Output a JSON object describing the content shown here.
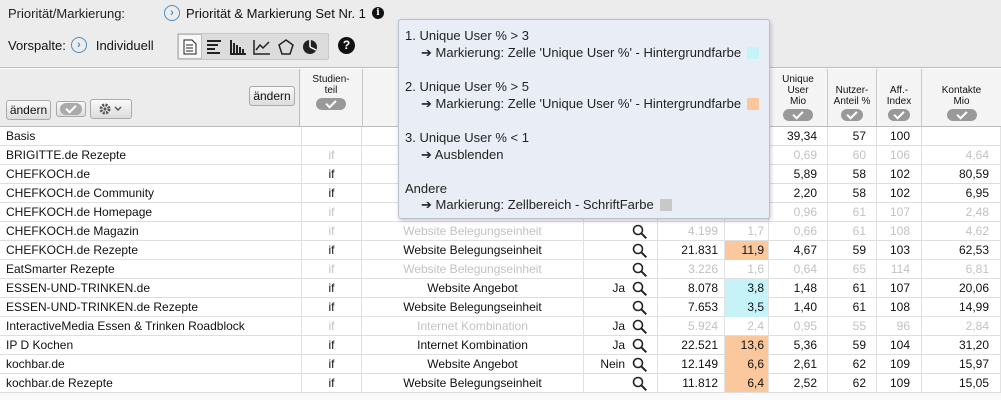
{
  "prio": {
    "label": "Priorität/Markierung:",
    "value": "Priorität & Markierung Set Nr. 1"
  },
  "vorspalte": {
    "label": "Vorspalte:",
    "value": "Individuell"
  },
  "icons": [
    "document-icon",
    "bar-chart-horizontal-icon",
    "bar-chart-vertical-icon",
    "line-chart-icon",
    "pentagon-icon",
    "pie-chart-icon"
  ],
  "help": "?",
  "controls": {
    "aendern1": "ändern",
    "aendern2": "ändern"
  },
  "headers": {
    "studienteil": "Studien-\nteil",
    "unique_user_mio": "Unique\nUser\nMio",
    "nutzer_anteil": "Nutzer-\nAnteil %",
    "aff_index": "Aff.-\nIndex",
    "kontakte_mio": "Kontakte\nMio"
  },
  "rows": [
    {
      "name": "Basis",
      "st": "",
      "ein": "",
      "ja": "",
      "mag": false,
      "bk": "",
      "uu": "",
      "mio": "39,34",
      "na": "57",
      "ai": "100",
      "km": "",
      "grey": false,
      "hl": ""
    },
    {
      "name": "BRIGITTE.de Rezepte",
      "st": "if",
      "ein": "",
      "ja": "",
      "mag": false,
      "bk": "",
      "uu": "",
      "mio": "0,69",
      "na": "60",
      "ai": "106",
      "km": "4,64",
      "grey": true,
      "hl": ""
    },
    {
      "name": "CHEFKOCH.de",
      "st": "if",
      "ein": "",
      "ja": "",
      "mag": false,
      "bk": "",
      "uu": "",
      "mio": "5,89",
      "na": "58",
      "ai": "102",
      "km": "80,59",
      "grey": false,
      "hl": "or"
    },
    {
      "name": "CHEFKOCH.de Community",
      "st": "if",
      "ein": "",
      "ja": "",
      "mag": false,
      "bk": "",
      "uu": "",
      "mio": "2,20",
      "na": "58",
      "ai": "102",
      "km": "6,95",
      "grey": false,
      "hl": "or"
    },
    {
      "name": "CHEFKOCH.de Homepage",
      "st": "if",
      "ein": "",
      "ja": "",
      "mag": false,
      "bk": "",
      "uu": "",
      "mio": "0,96",
      "na": "61",
      "ai": "107",
      "km": "2,48",
      "grey": true,
      "hl": ""
    },
    {
      "name": "CHEFKOCH.de Magazin",
      "st": "if",
      "ein": "Website Belegungseinheit",
      "ja": "",
      "mag": true,
      "bk": "4.199",
      "uu": "1,7",
      "mio": "0,66",
      "na": "61",
      "ai": "108",
      "km": "4,62",
      "grey": true,
      "hl": ""
    },
    {
      "name": "CHEFKOCH.de Rezepte",
      "st": "if",
      "ein": "Website Belegungseinheit",
      "ja": "",
      "mag": true,
      "bk": "21.831",
      "uu": "11,9",
      "mio": "4,67",
      "na": "59",
      "ai": "103",
      "km": "62,53",
      "grey": false,
      "hl": "or"
    },
    {
      "name": "EatSmarter Rezepte",
      "st": "if",
      "ein": "Website Belegungseinheit",
      "ja": "",
      "mag": true,
      "bk": "3.226",
      "uu": "1,6",
      "mio": "0,64",
      "na": "65",
      "ai": "114",
      "km": "6,81",
      "grey": true,
      "hl": ""
    },
    {
      "name": "ESSEN-UND-TRINKEN.de",
      "st": "if",
      "ein": "Website Angebot",
      "ja": "Ja",
      "mag": true,
      "bk": "8.078",
      "uu": "3,8",
      "mio": "1,48",
      "na": "61",
      "ai": "107",
      "km": "20,06",
      "grey": false,
      "hl": "cy"
    },
    {
      "name": "ESSEN-UND-TRINKEN.de Rezepte",
      "st": "if",
      "ein": "Website Belegungseinheit",
      "ja": "",
      "mag": true,
      "bk": "7.653",
      "uu": "3,5",
      "mio": "1,40",
      "na": "61",
      "ai": "108",
      "km": "14,99",
      "grey": false,
      "hl": "cy"
    },
    {
      "name": "InteractiveMedia Essen & Trinken Roadblock",
      "st": "if",
      "ein": "Internet Kombination",
      "ja": "Ja",
      "mag": true,
      "bk": "5.924",
      "uu": "2,4",
      "mio": "0,95",
      "na": "55",
      "ai": "96",
      "km": "2,84",
      "grey": true,
      "hl": ""
    },
    {
      "name": "IP D Kochen",
      "st": "if",
      "ein": "Internet Kombination",
      "ja": "Ja",
      "mag": true,
      "bk": "22.521",
      "uu": "13,6",
      "mio": "5,36",
      "na": "59",
      "ai": "104",
      "km": "31,20",
      "grey": false,
      "hl": "or"
    },
    {
      "name": "kochbar.de",
      "st": "if",
      "ein": "Website Angebot",
      "ja": "Nein",
      "mag": true,
      "bk": "12.149",
      "uu": "6,6",
      "mio": "2,61",
      "na": "62",
      "ai": "109",
      "km": "15,97",
      "grey": false,
      "hl": "or"
    },
    {
      "name": "kochbar.de Rezepte",
      "st": "if",
      "ein": "Website Belegungseinheit",
      "ja": "",
      "mag": true,
      "bk": "11.812",
      "uu": "6,4",
      "mio": "2,52",
      "na": "62",
      "ai": "109",
      "km": "15,05",
      "grey": false,
      "hl": "or"
    }
  ],
  "popup": {
    "r1": "1. Unique User % > 3",
    "r1a": "➔ Markierung: Zelle 'Unique User %' - Hintergrundfarbe",
    "r2": "2. Unique User % > 5",
    "r2a": "➔ Markierung: Zelle 'Unique User %' - Hintergrundfarbe",
    "r3": "3. Unique User % < 1",
    "r3a": "➔ Ausblenden",
    "r4": "Andere",
    "r4a": "➔ Markierung: Zellbereich - SchriftFarbe",
    "colors": {
      "cyan": "#c5f3f8",
      "orange": "#fbc89e",
      "grey": "#c8c8c8"
    }
  }
}
